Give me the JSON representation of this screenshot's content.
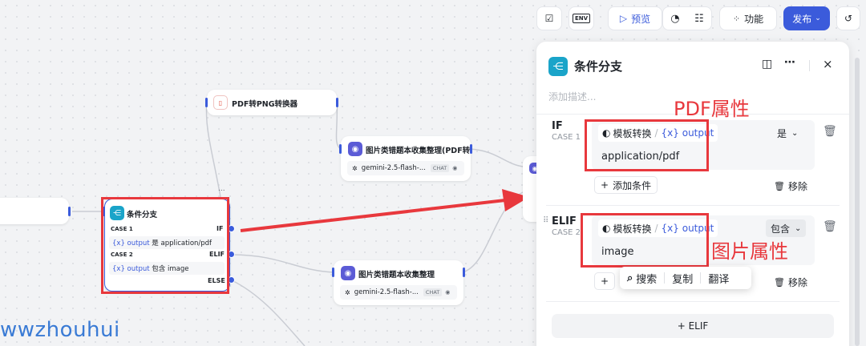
{
  "toolbar": {
    "preview_label": "预览",
    "features_label": "功能",
    "publish_label": "发布",
    "env_label": "ENV"
  },
  "canvas": {
    "nodes": {
      "pdf_converter": {
        "title": "PDF转PNG转换器"
      },
      "image_collect_pdf": {
        "title": "图片类错题本收集整理(PDF转",
        "model": "gemini-2.5-flash-...",
        "tag": "CHAT"
      },
      "condition": {
        "title": "条件分支",
        "case1": "CASE 1",
        "case1_kw": "IF",
        "case1_var": "{x} output",
        "case1_op": "是",
        "case1_value": "application/pdf",
        "case2": "CASE 2",
        "case2_kw": "ELIF",
        "case2_var": "{x} output",
        "case2_op": "包含",
        "case2_value": "image",
        "else_kw": "ELSE",
        "more": "..."
      },
      "image_collect": {
        "title": "图片类错题本收集整理",
        "model": "gemini-2.5-flash-...",
        "tag": "CHAT"
      }
    }
  },
  "panel": {
    "title": "条件分支",
    "description_placeholder": "添加描述...",
    "if_case": {
      "keyword": "IF",
      "case": "CASE 1",
      "source_node": "模板转换",
      "variable": "{x} output",
      "operator": "是",
      "value": "application/pdf",
      "add_condition": "添加条件",
      "remove": "移除"
    },
    "elif_case": {
      "keyword": "ELIF",
      "case": "CASE 2",
      "source_node": "模板转换",
      "variable": "{x} output",
      "operator": "包含",
      "value": "image",
      "remove": "移除"
    },
    "add_elif": "+ ELIF"
  },
  "context_menu": {
    "search": "搜索",
    "copy": "复制",
    "translate": "翻译"
  },
  "annotations": {
    "pdf_attr": "PDF属性",
    "image_attr": "图片属性"
  },
  "watermark": "wwzhouhui",
  "colors": {
    "accent": "#3b5bdb",
    "annotation_red": "#e8383d",
    "condition_icon": "#1aa4c9"
  }
}
